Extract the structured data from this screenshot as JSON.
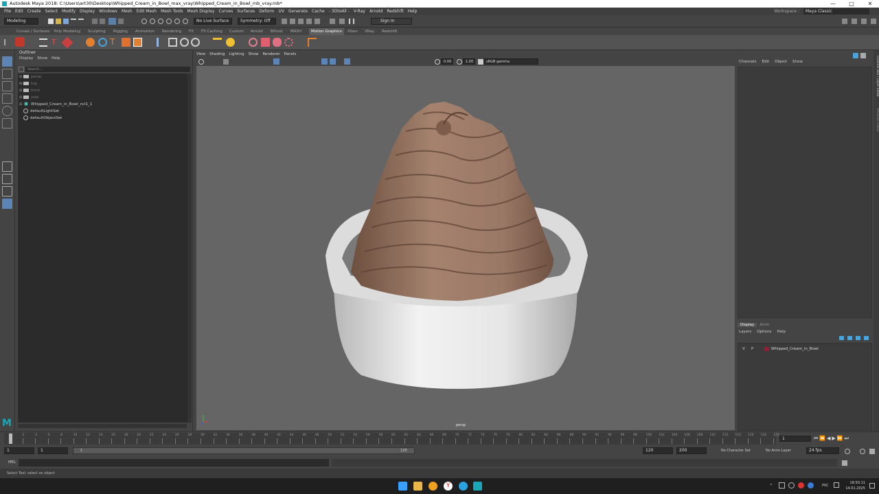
{
  "window": {
    "title": "Autodesk Maya 2018: C:\\Users\\art30\\Desktop\\Whipped_Cream_in_Bowl_max_vray\\Whipped_Cream_in_Bowl_mb_vray.mb*",
    "min": "—",
    "max": "□",
    "close": "✕"
  },
  "menubar": {
    "items": [
      "File",
      "Edit",
      "Create",
      "Select",
      "Modify",
      "Display",
      "Windows",
      "Mesh",
      "Edit Mesh",
      "Mesh Tools",
      "Mesh Display",
      "Curves",
      "Surfaces",
      "Deform",
      "UV",
      "Generate",
      "Cache",
      "- 3DtoAll -",
      "V-Ray",
      "Arnold",
      "Redshift",
      "Help"
    ],
    "workspace_label": "Workspace :",
    "workspace_value": "Maya Classic"
  },
  "statusline": {
    "mode": "Modeling",
    "live_surface": "No Live Surface",
    "symmetry": "Symmetry: Off",
    "sign_in": "Sign In"
  },
  "shelf": {
    "tabs": [
      "Curves / Surfaces",
      "Poly Modeling",
      "Sculpting",
      "Rigging",
      "Animation",
      "Rendering",
      "FX",
      "FX Caching",
      "Custom",
      "Arnold",
      "Bifrost",
      "MASH",
      "Motion Graphics",
      "XGen",
      "VRay",
      "Redshift"
    ],
    "active_tab": "Motion Graphics"
  },
  "outliner": {
    "title": "Outliner",
    "menu": [
      "Display",
      "Show",
      "Help"
    ],
    "search_placeholder": "Search...",
    "items": [
      {
        "label": "persp",
        "kind": "camera",
        "dim": true
      },
      {
        "label": "top",
        "kind": "camera",
        "dim": true
      },
      {
        "label": "front",
        "kind": "camera",
        "dim": true
      },
      {
        "label": "side",
        "kind": "camera",
        "dim": true
      },
      {
        "label": "Whipped_Cream_in_Bowl_ncl1_1",
        "kind": "group",
        "dim": false
      },
      {
        "label": "defaultLightSet",
        "kind": "set",
        "dim": false
      },
      {
        "label": "defaultObjectSet",
        "kind": "set",
        "dim": false
      }
    ]
  },
  "viewport": {
    "menu": [
      "View",
      "Shading",
      "Lighting",
      "Show",
      "Renderer",
      "Panels"
    ],
    "exposure": "0.00",
    "gamma": "1.00",
    "color_space": "sRGB gamma",
    "camera_label": "persp"
  },
  "channelbox": {
    "menu": [
      "Channels",
      "Edit",
      "Object",
      "Show"
    ]
  },
  "layers": {
    "tabs": [
      "Display",
      "Anim"
    ],
    "menu": [
      "Layers",
      "Options",
      "Help"
    ],
    "layer": {
      "v": "V",
      "p": "P",
      "name": "Whipped_Cream_in_Bowl",
      "color": "#9b1b30"
    }
  },
  "sidetabs": {
    "a": "Channel Box / Layer Editor",
    "b": "Attribute Editor"
  },
  "timeslider": {
    "ticks": [
      "1",
      "2",
      "4",
      "6",
      "8",
      "10",
      "12",
      "14",
      "16",
      "18",
      "20",
      "22",
      "24",
      "26",
      "28",
      "30",
      "32",
      "34",
      "36",
      "38",
      "40",
      "42",
      "44",
      "46",
      "48",
      "50",
      "52",
      "54",
      "56",
      "58",
      "60",
      "62",
      "64",
      "66",
      "68",
      "70",
      "72",
      "74",
      "76",
      "78",
      "80",
      "82",
      "84",
      "86",
      "88",
      "90",
      "92",
      "94",
      "96",
      "98",
      "100",
      "102",
      "104",
      "106",
      "108",
      "110",
      "112",
      "114",
      "116",
      "118",
      "120"
    ],
    "current": "1"
  },
  "range": {
    "start": "1",
    "playback_start": "1",
    "slider_start": "1",
    "slider_end": "120",
    "end": "120",
    "anim_end": "200",
    "character_set": "No Character Set",
    "anim_layer": "No Anim Layer",
    "fps": "24 fps"
  },
  "cmdline": {
    "label": "MEL"
  },
  "helpline": {
    "text": "Select Tool: select an object"
  },
  "taskbar": {
    "lang": "РУС",
    "time": "18:50:11",
    "date": "14.01.2025"
  }
}
